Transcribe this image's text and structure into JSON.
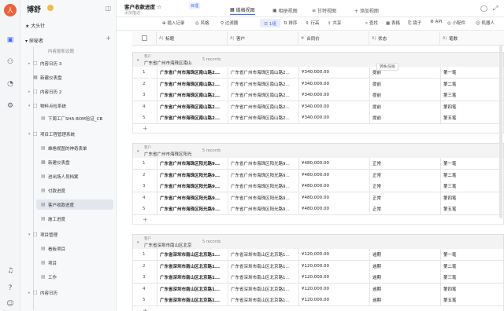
{
  "rail": {
    "avatar": "人",
    "icons": [
      "screen-icon",
      "people-icon",
      "chart-icon",
      "gear-icon",
      "bell-icon",
      "help-icon",
      "user-icon"
    ]
  },
  "sidebar": {
    "brand": "博舒",
    "groups": [
      {
        "label": "大头针"
      },
      {
        "label": "探秘者"
      }
    ],
    "items": [
      {
        "label": "内容复和议题",
        "car": "",
        "icon": "",
        "indent": 1
      },
      {
        "label": "内容日历 3",
        "car": "▸",
        "icon": "□",
        "indent": 0
      },
      {
        "label": "新建仪表盘",
        "car": "",
        "icon": "▦",
        "indent": 0
      },
      {
        "label": "内容日历 2",
        "car": "▸",
        "icon": "□",
        "indent": 0
      },
      {
        "label": "新建仪表盘",
        "car": "",
        "icon": "▦",
        "indent": 0
      },
      {
        "label": "物料点检系统",
        "car": "▾",
        "icon": "□",
        "indent": 0
      },
      {
        "label": "下周工厂SHA BOM验证_CB",
        "car": "",
        "icon": "▤",
        "indent": 1
      },
      {
        "label": "项目工程管理系统",
        "car": "▾",
        "icon": "□",
        "indent": 0
      },
      {
        "label": "维格视图的神奇表单",
        "car": "",
        "icon": "▤",
        "indent": 1
      },
      {
        "label": "新建仪表盘",
        "car": "",
        "icon": "▦",
        "indent": 1
      },
      {
        "label": "进出场人员档案",
        "car": "",
        "icon": "▤",
        "indent": 1
      },
      {
        "label": "付款进度",
        "car": "",
        "icon": "▤",
        "indent": 1
      },
      {
        "label": "客户收款进度",
        "car": "",
        "icon": "▤",
        "indent": 1,
        "selected": true
      },
      {
        "label": "施工进度",
        "car": "",
        "icon": "▤",
        "indent": 1
      },
      {
        "label": "项目管理",
        "car": "▾",
        "icon": "□",
        "indent": 0
      },
      {
        "label": "看板项目",
        "car": "",
        "icon": "▤",
        "indent": 1
      },
      {
        "label": "项目",
        "car": "",
        "icon": "▤",
        "indent": 1
      },
      {
        "label": "工作",
        "car": "",
        "icon": "▤",
        "indent": 1
      },
      {
        "label": "内容日历",
        "car": "▸",
        "icon": "□",
        "indent": 0
      }
    ]
  },
  "topbar": {
    "title": "客户收款进度 ☆",
    "badge": "目理",
    "desc": "添加描述",
    "tabs": [
      {
        "label": "维格视图",
        "active": true
      },
      {
        "label": "相册视图",
        "active": false
      },
      {
        "label": "甘特视图",
        "active": false
      },
      {
        "label": "+ 添加视图",
        "active": false
      }
    ]
  },
  "toolbar": {
    "items": [
      "⊕ 插入记录",
      "◎ 风格",
      "⚲ 过滤器",
      "☰ 1组",
      "⇅ 排序",
      "⇕ 行高",
      "⇪ 共享",
      "⌕ 查找",
      "▦ 表格",
      "⎘ 镜子",
      "⚙ API",
      "◎ 小配件",
      "☺ 机器人"
    ]
  },
  "header": {
    "columns": [
      {
        "type": "A|",
        "label": "标题"
      },
      {
        "type": "A|",
        "label": "客户"
      },
      {
        "type": "#",
        "label": "合同价"
      },
      {
        "type": "A|",
        "label": "状态"
      },
      {
        "type": "A|",
        "label": "笔数"
      }
    ]
  },
  "groups": [
    {
      "key": "客户",
      "value": "广东省广州市海珠区南山",
      "count": "5 records",
      "rows": [
        {
          "n": "1",
          "title": "广东省广州市海珠区南山路2...",
          "customer": "广东省广州市海珠区南山路2...",
          "price": "¥340,000.00",
          "status": "提前",
          "count": "第一笔"
        },
        {
          "n": "2",
          "title": "广东省广州市海珠区南山路2...",
          "customer": "广东省广州市海珠区南山路2...",
          "price": "¥340,000.00",
          "status": "提前",
          "count": "第二笔"
        },
        {
          "n": "3",
          "title": "广东省广州市海珠区南山路2...",
          "customer": "广东省广州市海珠区南山路2...",
          "price": "¥340,000.00",
          "status": "提前",
          "count": "第三笔"
        },
        {
          "n": "4",
          "title": "广东省广州市海珠区南山路2...",
          "customer": "广东省广州市海珠区南山路2...",
          "price": "¥340,000.00",
          "status": "提前",
          "count": "第四笔"
        },
        {
          "n": "5",
          "title": "广东省广州市海珠区南山路2...",
          "customer": "广东省广州市海珠区南山路2...",
          "price": "¥340,000.00",
          "status": "提前",
          "count": "第五笔"
        }
      ]
    },
    {
      "key": "客户",
      "value": "广东省广州市海珠区阳光",
      "count": "5 records",
      "rows": [
        {
          "n": "1",
          "title": "广东省广州市海珠区阳光路9...",
          "customer": "广东省广州市海珠区阳光路9...",
          "price": "¥480,000.00",
          "status": "正常",
          "count": "第一笔"
        },
        {
          "n": "2",
          "title": "广东省广州市海珠区阳光路9...",
          "customer": "广东省广州市海珠区阳光路9...",
          "price": "¥480,000.00",
          "status": "正常",
          "count": "第二笔"
        },
        {
          "n": "3",
          "title": "广东省广州市海珠区阳光路9...",
          "customer": "广东省广州市海珠区阳光路9...",
          "price": "¥480,000.00",
          "status": "正常",
          "count": "第三笔"
        },
        {
          "n": "4",
          "title": "广东省广州市海珠区阳光路9...",
          "customer": "广东省广州市海珠区阳光路9...",
          "price": "¥480,000.00",
          "status": "正常",
          "count": "第四笔"
        },
        {
          "n": "5",
          "title": "广东省广州市海珠区阳光路9...",
          "customer": "广东省广州市海珠区阳光路9...",
          "price": "¥480,000.00",
          "status": "正常",
          "count": "第五笔"
        }
      ]
    },
    {
      "key": "客户",
      "value": "广东省深圳市南山区北京",
      "count": "5 records",
      "rows": [
        {
          "n": "1",
          "title": "广东省深圳市南山区北京路1...",
          "customer": "广东省深圳市南山区北京路1...",
          "price": "¥120,000.00",
          "status": "逾期",
          "count": "第一笔"
        },
        {
          "n": "2",
          "title": "广东省深圳市南山区北京路1...",
          "customer": "广东省深圳市南山区北京路1...",
          "price": "¥120,000.00",
          "status": "逾期",
          "count": "第二笔"
        },
        {
          "n": "3",
          "title": "广东省深圳市南山区北京路1...",
          "customer": "广东省深圳市南山区北京路1...",
          "price": "¥120,000.00",
          "status": "逾期",
          "count": "第三笔"
        },
        {
          "n": "4",
          "title": "广东省深圳市南山区北京路1...",
          "customer": "广东省深圳市南山区北京路1...",
          "price": "¥120,000.00",
          "status": "逾期",
          "count": "第四笔"
        },
        {
          "n": "5",
          "title": "广东省深圳市南山区北京路1...",
          "customer": "广东省深圳市南山区北京路1...",
          "price": "¥120,000.00",
          "status": "逾期",
          "count": "第五笔"
        }
      ]
    }
  ],
  "tooltip": "转换/压缩",
  "colors": {
    "accent": "#4a6cf7",
    "avatar": "#e8643b"
  }
}
